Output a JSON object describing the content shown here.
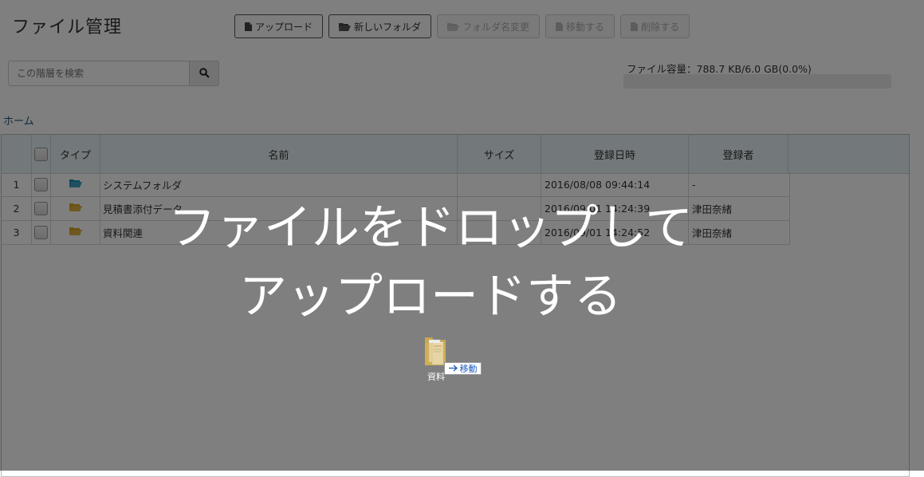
{
  "page": {
    "title": "ファイル管理"
  },
  "toolbar": {
    "upload": "アップロード",
    "new_folder": "新しいフォルダ",
    "rename_folder": "フォルダ名変更",
    "move": "移動する",
    "delete": "削除する"
  },
  "search": {
    "placeholder": "この階層を検索"
  },
  "capacity": {
    "label": "ファイル容量：788.7 KB/6.0 GB(0.0%)",
    "percent": 0.0
  },
  "breadcrumb": {
    "home": "ホーム"
  },
  "grid": {
    "columns": {
      "type": "タイプ",
      "name": "名前",
      "size": "サイズ",
      "date": "登録日時",
      "registrant": "登録者"
    },
    "rows": [
      {
        "num": "1",
        "folder_color": "#1a8fb8",
        "name": "システムフォルダ",
        "size": "",
        "date": "2016/08/08 09:44:14",
        "registrant": "-"
      },
      {
        "num": "2",
        "folder_color": "#d9a520",
        "name": "見積書添付データ",
        "size": "",
        "date": "2016/09/01 14:24:39",
        "registrant": "津田奈緒"
      },
      {
        "num": "3",
        "folder_color": "#d9a520",
        "name": "資料関連",
        "size": "",
        "date": "2016/09/01 14:24:52",
        "registrant": "津田奈緒"
      }
    ]
  },
  "drop_overlay": {
    "line1": "ファイルをドロップして",
    "line2": "アップロードする",
    "drag_file_label": "資料",
    "move_badge": "移動"
  }
}
